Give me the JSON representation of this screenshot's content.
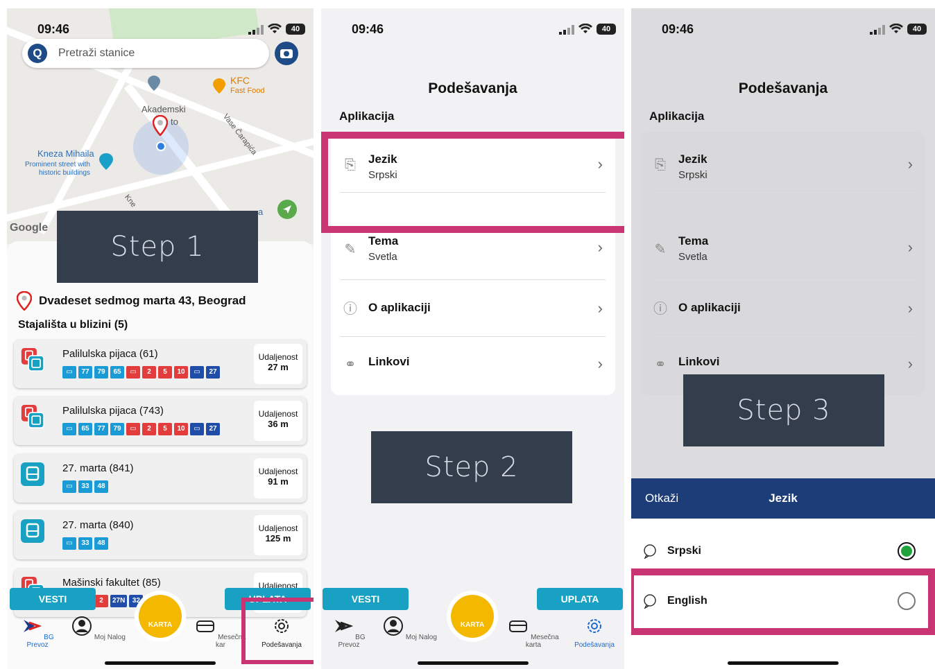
{
  "status": {
    "time": "09:46",
    "battery": "40"
  },
  "screen1": {
    "search_placeholder": "Pretraži stanice",
    "map_labels": {
      "kfc": "KFC",
      "kfc_sub": "Fast Food",
      "akademski": "Akademski",
      "akademski_2": "to",
      "kneza": "Kneza Mihaila",
      "kneza_sub1": "Prominent street with",
      "kneza_sub2": "historic buildings",
      "vase": "Vase Čarapića",
      "street2": "Kne",
      "street3": "a",
      "google": "Google"
    },
    "step": "Step 1",
    "address": "Dvadeset sedmog marta 43, Beograd",
    "nearby_title": "Stajališta u blizini (5)",
    "distance_label": "Udaljenost",
    "stops": [
      {
        "name": "Palilulska pijaca (61)",
        "distance": "27 m",
        "kind": "tram-bus",
        "lines": [
          {
            "t": "bus",
            "n": "▭"
          },
          {
            "t": "bus",
            "n": "77"
          },
          {
            "t": "bus",
            "n": "79"
          },
          {
            "t": "bus",
            "n": "65"
          },
          {
            "t": "tram",
            "n": "▭"
          },
          {
            "t": "tram",
            "n": "2"
          },
          {
            "t": "tram",
            "n": "5"
          },
          {
            "t": "tram",
            "n": "10"
          },
          {
            "t": "trol",
            "n": "▭"
          },
          {
            "t": "trol",
            "n": "27"
          }
        ]
      },
      {
        "name": "Palilulska pijaca (743)",
        "distance": "36 m",
        "kind": "tram-bus",
        "lines": [
          {
            "t": "bus",
            "n": "▭"
          },
          {
            "t": "bus",
            "n": "65"
          },
          {
            "t": "bus",
            "n": "77"
          },
          {
            "t": "bus",
            "n": "79"
          },
          {
            "t": "tram",
            "n": "▭"
          },
          {
            "t": "tram",
            "n": "2"
          },
          {
            "t": "tram",
            "n": "5"
          },
          {
            "t": "tram",
            "n": "10"
          },
          {
            "t": "trol",
            "n": "▭"
          },
          {
            "t": "trol",
            "n": "27"
          }
        ]
      },
      {
        "name": "27. marta (841)",
        "distance": "91 m",
        "kind": "bus",
        "lines": [
          {
            "t": "bus",
            "n": "▭"
          },
          {
            "t": "bus",
            "n": "33"
          },
          {
            "t": "bus",
            "n": "48"
          }
        ]
      },
      {
        "name": "27. marta (840)",
        "distance": "125 m",
        "kind": "bus",
        "lines": [
          {
            "t": "bus",
            "n": "▭"
          },
          {
            "t": "bus",
            "n": "33"
          },
          {
            "t": "bus",
            "n": "48"
          }
        ]
      },
      {
        "name": "Mašinski fakultet (85)",
        "distance": "",
        "kind": "tram-bus",
        "lines": [
          {
            "t": "bus",
            "n": "5"
          },
          {
            "t": "tram",
            "n": "▭"
          },
          {
            "t": "tram",
            "n": "2"
          },
          {
            "t": "trol",
            "n": "27N"
          },
          {
            "t": "trol",
            "n": "32"
          }
        ]
      }
    ]
  },
  "buttons": {
    "vesti": "VESTI",
    "uplata": "UPLATA"
  },
  "tabs": {
    "bg_prevoz": "BG Prevoz",
    "moj_nalog": "Moj Nalog",
    "karta": "KARTA",
    "mesecna1": "Mesečna kar",
    "mesecna": "Mesečna karta",
    "podesavanja": "Podešavanja"
  },
  "settings": {
    "title": "Podešavanja",
    "section": "Aplikacija",
    "rows": [
      {
        "title": "Jezik",
        "sub": "Srpski"
      },
      {
        "title": "Tema",
        "sub": "Svetla"
      },
      {
        "title": "O aplikaciji",
        "sub": ""
      },
      {
        "title": "Linkovi",
        "sub": ""
      }
    ],
    "step2": "Step 2",
    "step3": "Step 3"
  },
  "language_modal": {
    "cancel": "Otkaži",
    "title": "Jezik",
    "options": [
      {
        "label": "Srpski",
        "selected": true
      },
      {
        "label": "English",
        "selected": false
      }
    ]
  },
  "colors": {
    "highlight": "#c93572",
    "accent": "#1d3d78",
    "karta": "#f5b800",
    "button": "#19a1c3",
    "step_bg": "#333d4c"
  }
}
